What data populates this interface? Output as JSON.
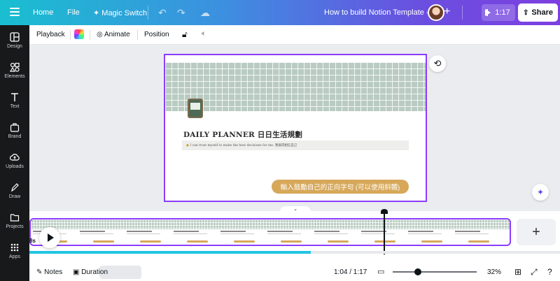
{
  "topbar": {
    "home": "Home",
    "file": "File",
    "magic_switch": "Magic Switch",
    "doc_title": "How to build Notion Template -1",
    "play_time": "1:17",
    "share": "Share"
  },
  "sidebar": {
    "items": [
      {
        "label": "Design",
        "icon": "design-icon"
      },
      {
        "label": "Elements",
        "icon": "elements-icon"
      },
      {
        "label": "Text",
        "icon": "text-icon"
      },
      {
        "label": "Brand",
        "icon": "brand-icon"
      },
      {
        "label": "Uploads",
        "icon": "uploads-icon"
      },
      {
        "label": "Draw",
        "icon": "draw-icon"
      },
      {
        "label": "Projects",
        "icon": "projects-icon"
      },
      {
        "label": "Apps",
        "icon": "apps-icon"
      }
    ]
  },
  "toolbar": {
    "playback": "Playback",
    "animate": "Animate",
    "position": "Position"
  },
  "design": {
    "title": "DAILY PLANNER 日日生活規劃",
    "quote_text": "I can trust myself to make the best decisions for me.",
    "quote_cn": "我值得相信自己",
    "cta": "輸入鼓勵自己的正向字句 (可以使用斜體)"
  },
  "timeline": {
    "duration_badge": "8s",
    "progress": 0.53
  },
  "bottombar": {
    "notes": "Notes",
    "duration": "Duration",
    "time": "1:04 / 1:17",
    "zoom": "32%"
  },
  "colors": {
    "accent": "#8b3dff",
    "cta": "#d7a85a",
    "progress": "#22c4e3"
  }
}
